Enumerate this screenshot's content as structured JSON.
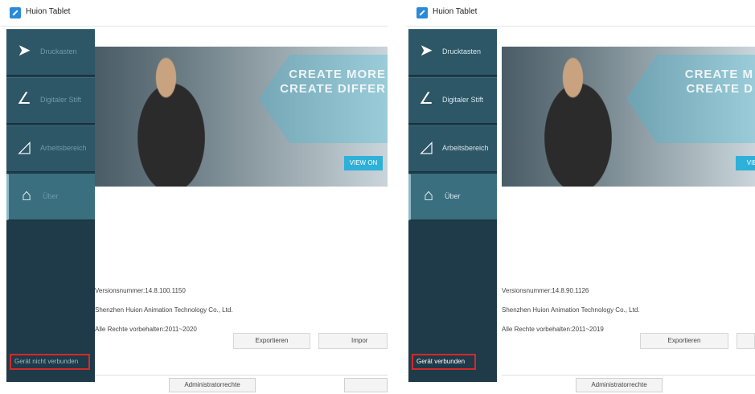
{
  "left": {
    "title": "Huion Tablet",
    "nav": [
      {
        "label": "Druckasten",
        "icon": "send-icon"
      },
      {
        "label": "Digitaler Stift",
        "icon": "pen-icon"
      },
      {
        "label": "Arbeitsbereich",
        "icon": "area-icon"
      },
      {
        "label": "Über",
        "icon": "home-icon"
      }
    ],
    "banner": {
      "text": "CREATE MORE\nCREATE DIFFER",
      "button": "VIEW ON"
    },
    "version": "Versionsnummer:14.8.100.1150",
    "company": "Shenzhen Huion Animation Technology Co., Ltd.",
    "rights": "Alle Rechte vorbehalten:2011~2020",
    "export_label": "Exportieren",
    "import_label": "Impor",
    "status": "Gerät nicht verbunden",
    "admin_label": "Administratorrechte"
  },
  "right": {
    "title": "Huion Tablet",
    "nav": [
      {
        "label": "Drucktasten",
        "icon": "send-icon"
      },
      {
        "label": "Digitaler Stift",
        "icon": "pen-icon"
      },
      {
        "label": "Arbeitsbereich",
        "icon": "area-icon"
      },
      {
        "label": "Über",
        "icon": "home-icon"
      }
    ],
    "banner": {
      "text": "CREATE M\nCREATE D",
      "button": "VIEW"
    },
    "version": "Versionsnummer:14.8.90.1126",
    "company": "Shenzhen Huion Animation Technology Co., Ltd.",
    "rights": "Alle Rechte vorbehalten:2011~2019",
    "export_label": "Exportieren",
    "status": "Gerät verbunden",
    "admin_label": "Administratorrechte"
  },
  "colors": {
    "sidebar": "#1f3a48",
    "nav": "#2d5767",
    "highlight": "#d42a2a",
    "accent": "#2fb0d8"
  }
}
